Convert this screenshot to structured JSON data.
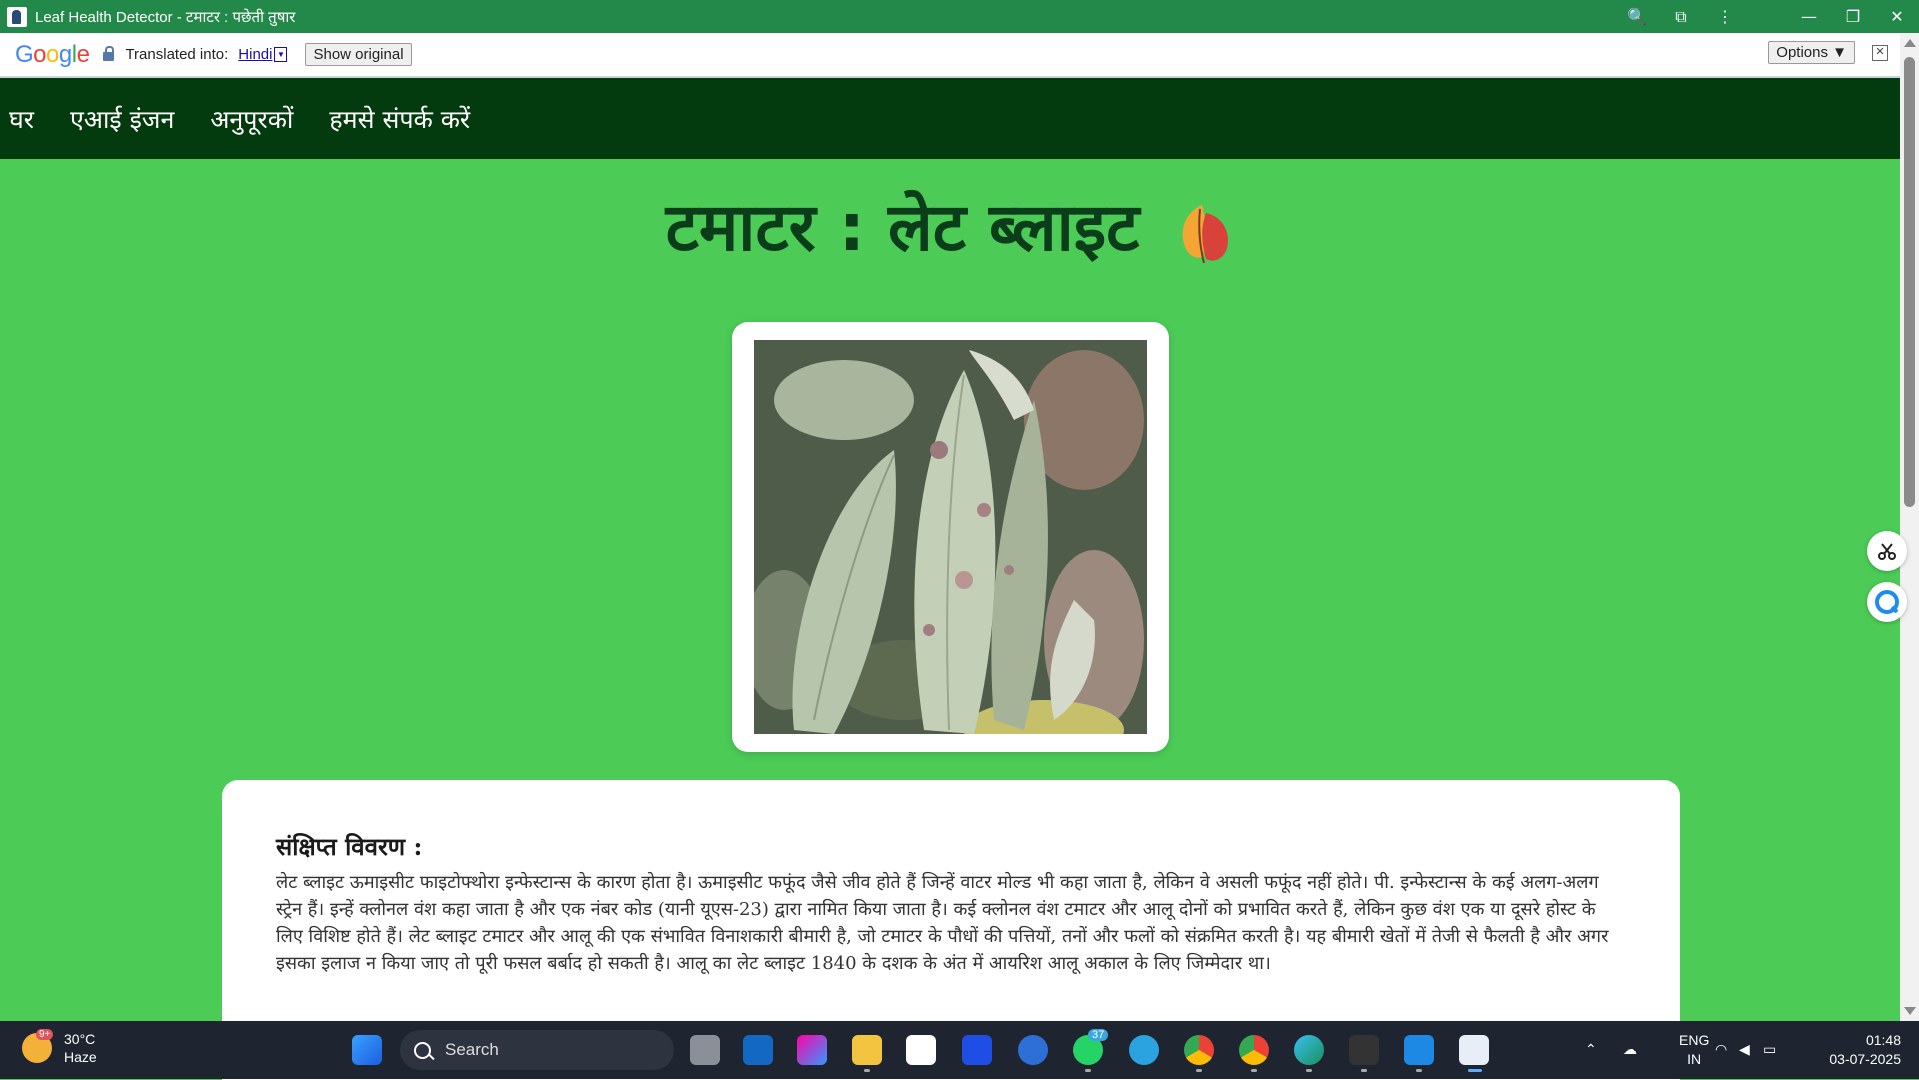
{
  "window": {
    "title": "Leaf Health Detector - टमाटर : पछेती तुषार",
    "controls": {
      "zoom": "🔍",
      "extensions": "⧉",
      "menu": "⋮",
      "minimize": "—",
      "restore": "❐",
      "close": "✕"
    }
  },
  "translate_bar": {
    "logo": "Google",
    "label": "Translated into:",
    "language": "Hindi",
    "language_caret": "▼",
    "show_original": "Show original",
    "options": "Options ▼",
    "close": "✕"
  },
  "nav": {
    "items": [
      "घर",
      "एआई इंजन",
      "अनुपूरकों",
      "हमसे संपर्क करें"
    ]
  },
  "page": {
    "title": "टमाटर : लेट ब्लाइट",
    "description_heading": "संक्षिप्त विवरण :",
    "description": "लेट ब्लाइट ऊमाइसीट फाइटोफ्थोरा इन्फेस्टान्स के कारण होता है। ऊमाइसीट फफूंद जैसे जीव होते हैं जिन्हें वाटर मोल्ड भी कहा जाता है, लेकिन वे असली फफूंद नहीं होते। पी. इन्फेस्टान्स के कई अलग-अलग स्ट्रेन हैं। इन्हें क्लोनल वंश कहा जाता है और एक नंबर कोड (यानी यूएस-23) द्वारा नामित किया जाता है। कई क्लोनल वंश टमाटर और आलू दोनों को प्रभावित करते हैं, लेकिन कुछ वंश एक या दूसरे होस्ट के लिए विशिष्ट होते हैं। लेट ब्लाइट टमाटर और आलू की एक संभावित विनाशकारी बीमारी है, जो टमाटर के पौधों की पत्तियों, तनों और फलों को संक्रमित करती है। यह बीमारी खेतों में तेजी से फैलती है और अगर इसका इलाज न किया जाए तो पूरी फसल बर्बाद हो सकती है। आलू का लेट ब्लाइट 1840 के दशक के अंत में आयरिश आलू अकाल के लिए जिम्मेदार था।"
  },
  "taskbar": {
    "weather_temp": "30°C",
    "weather_desc": "Haze",
    "weather_badge": "9+",
    "search_label": "Search",
    "whatsapp_badge": "37",
    "lang_line1": "ENG",
    "lang_line2": "IN",
    "time": "01:48",
    "date": "03-07-2025"
  },
  "colors": {
    "titlebar": "#23894a",
    "nav": "#043b0e",
    "page_bg": "#4ccb57",
    "title_text": "#0c3d1a",
    "taskbar": "#1e2530"
  }
}
